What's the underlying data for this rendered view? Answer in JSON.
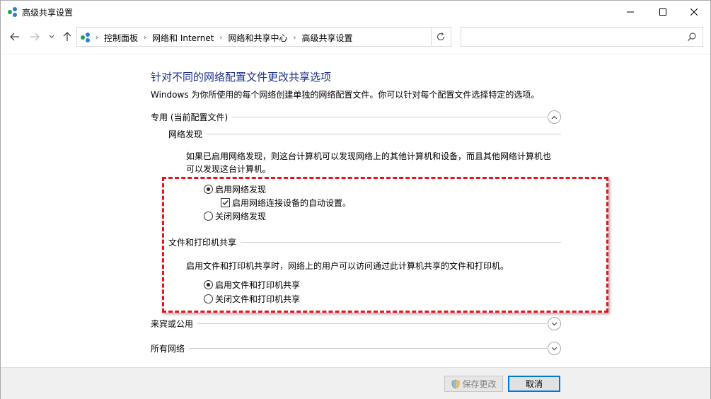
{
  "window": {
    "title": "高级共享设置"
  },
  "address": {
    "crumbs": [
      "控制面板",
      "网络和 Internet",
      "网络和共享中心",
      "高级共享设置"
    ],
    "search_placeholder": ""
  },
  "content": {
    "heading": "针对不同的网络配置文件更改共享选项",
    "description": "Windows 为你所使用的每个网络创建单独的网络配置文件。你可以针对每个配置文件选择特定的选项。",
    "profiles": {
      "private": {
        "label": "专用 (当前配置文件)",
        "expanded": true,
        "network_discovery": {
          "title": "网络发现",
          "description_line1": "如果已启用网络发现，则这台计算机可以发现网络上的其他计算机和设备，而且其他网络计算机也",
          "description_line2": "可以发现这台计算机。",
          "option_on": "启用网络发现",
          "option_auto": "启用网络连接设备的自动设置。",
          "option_off": "关闭网络发现",
          "selected": "on",
          "auto_checked": true
        },
        "file_printer_sharing": {
          "title": "文件和打印机共享",
          "description": "启用文件和打印机共享时，网络上的用户可以访问通过此计算机共享的文件和打印机。",
          "option_on": "启用文件和打印机共享",
          "option_off": "关闭文件和打印机共享",
          "selected": "on"
        }
      },
      "guest_public": {
        "label": "来宾或公用",
        "expanded": false
      },
      "all_networks": {
        "label": "所有网络",
        "expanded": false
      }
    }
  },
  "footer": {
    "save_label": "保存更改",
    "cancel_label": "取消"
  },
  "colors": {
    "heading": "#1e3287",
    "highlight_border": "#e8141b",
    "accent": "#0078d7"
  }
}
